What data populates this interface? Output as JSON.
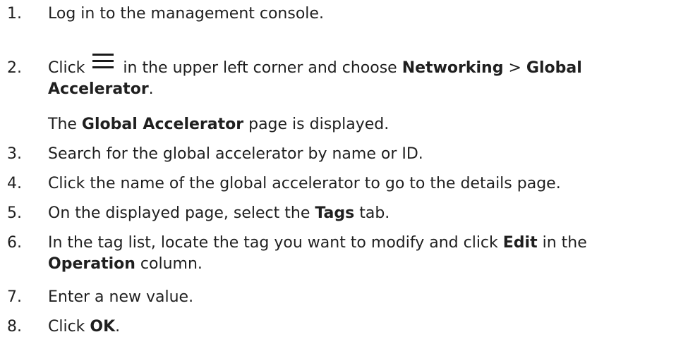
{
  "steps": [
    {
      "num": "1.",
      "text": "Log in to the management console."
    },
    {
      "num": "2.",
      "prefix": "Click",
      "icon": "hamburger-menu-icon",
      "mid": "in the upper left corner and choose",
      "bold1": "Networking",
      "sep": ">",
      "bold2": "Global",
      "bold3": "Accelerator",
      "end": ".",
      "note_bold": "Global Accelerator",
      "note_pre": "The",
      "note_post": "page is displayed."
    },
    {
      "num": "3.",
      "text": "Search for the global accelerator by name or ID."
    },
    {
      "num": "4.",
      "text": "Click the name of the global accelerator to go to the details page."
    },
    {
      "num": "5.",
      "pre": "On the displayed page, select the",
      "bold": "Tags",
      "post": "tab."
    },
    {
      "num": "6.",
      "pre": "In the tag list, locate the tag you want to modify and click",
      "bold": "Edit",
      "post": "in the",
      "bold2": "Operation",
      "post2": "column."
    },
    {
      "num": "7.",
      "text": "Enter a new value."
    },
    {
      "num": "8.",
      "pre": "Click",
      "bold": "OK",
      "post": "."
    }
  ]
}
